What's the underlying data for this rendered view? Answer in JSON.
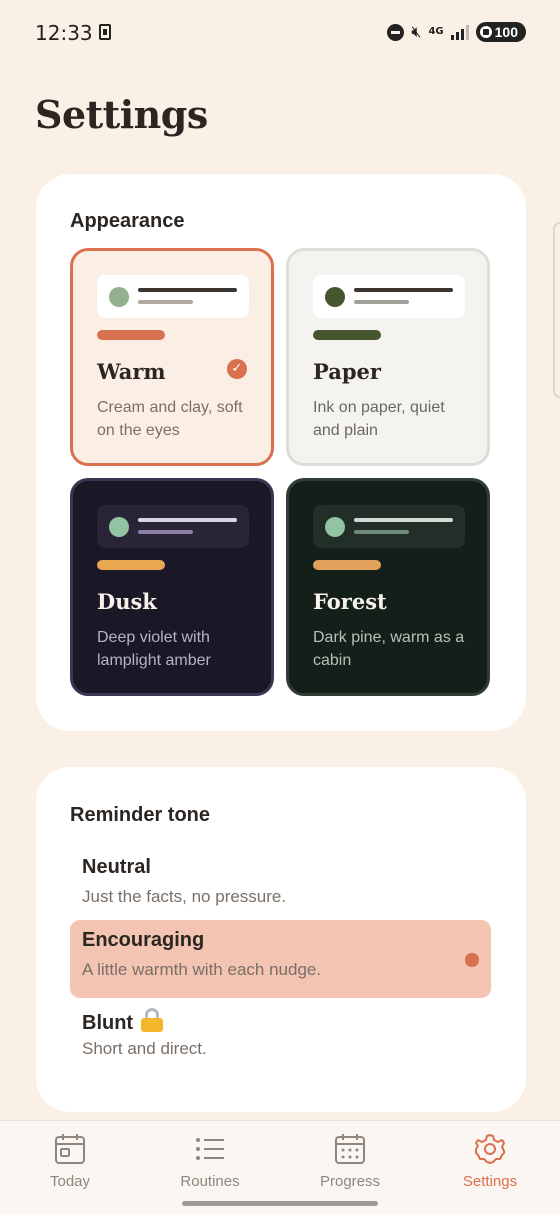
{
  "status_bar": {
    "time": "12:33",
    "network": "4G",
    "battery": "100"
  },
  "page": {
    "title": "Settings"
  },
  "appearance": {
    "heading": "Appearance",
    "themes": [
      {
        "name": "Warm",
        "description": "Cream and clay, soft on the eyes",
        "selected": true,
        "bg": "#fbefe5",
        "border": "#d9714f",
        "preview_bg": "#ffffff",
        "dot": "#93b08f",
        "line1": "#3a3530",
        "line2": "#b3a89e",
        "accent": "#d9714f",
        "name_color": "#2b2622",
        "desc_color": "#7a6f67"
      },
      {
        "name": "Paper",
        "description": "Ink on paper, quiet and plain",
        "selected": false,
        "bg": "#f4f3ef",
        "border": "#deddd6",
        "preview_bg": "#ffffff",
        "dot": "#45562f",
        "line1": "#3a3530",
        "line2": "#a2a09a",
        "accent": "#45562f",
        "name_color": "#2b2622",
        "desc_color": "#6b6863"
      },
      {
        "name": "Dusk",
        "description": "Deep violet with lamplight amber",
        "selected": false,
        "bg": "#1b1726",
        "border": "#3b3553",
        "preview_bg": "#2a2536",
        "dot": "#93c4a1",
        "line1": "#d8d4e4",
        "line2": "#8a80a8",
        "accent": "#e7a851",
        "name_color": "#f5f2ea",
        "desc_color": "#b8b2c6"
      },
      {
        "name": "Forest",
        "description": "Dark pine, warm as a cabin",
        "selected": false,
        "bg": "#141f1a",
        "border": "#2f3d35",
        "preview_bg": "#222e28",
        "dot": "#93c4a1",
        "line1": "#d2d8d2",
        "line2": "#6f8a78",
        "accent": "#e0a25a",
        "name_color": "#f5f2ea",
        "desc_color": "#b7c1b9"
      }
    ]
  },
  "reminder_tone": {
    "heading": "Reminder tone",
    "options": [
      {
        "label": "Neutral",
        "description": "Just the facts, no pressure.",
        "selected": false,
        "locked": false
      },
      {
        "label": "Encouraging",
        "description": "A little warmth with each nudge.",
        "selected": true,
        "locked": false
      },
      {
        "label": "Blunt",
        "description": "Short and direct.",
        "selected": false,
        "locked": true
      }
    ]
  },
  "nav": {
    "items": [
      {
        "label": "Today",
        "icon": "calendar-day-icon",
        "active": false
      },
      {
        "label": "Routines",
        "icon": "list-icon",
        "active": false
      },
      {
        "label": "Progress",
        "icon": "calendar-grid-icon",
        "active": false
      },
      {
        "label": "Settings",
        "icon": "gear-icon",
        "active": true
      }
    ]
  },
  "colors": {
    "background": "#faf0e6",
    "accent": "#d9714f",
    "selected_tone_bg": "#f2c4b1"
  }
}
